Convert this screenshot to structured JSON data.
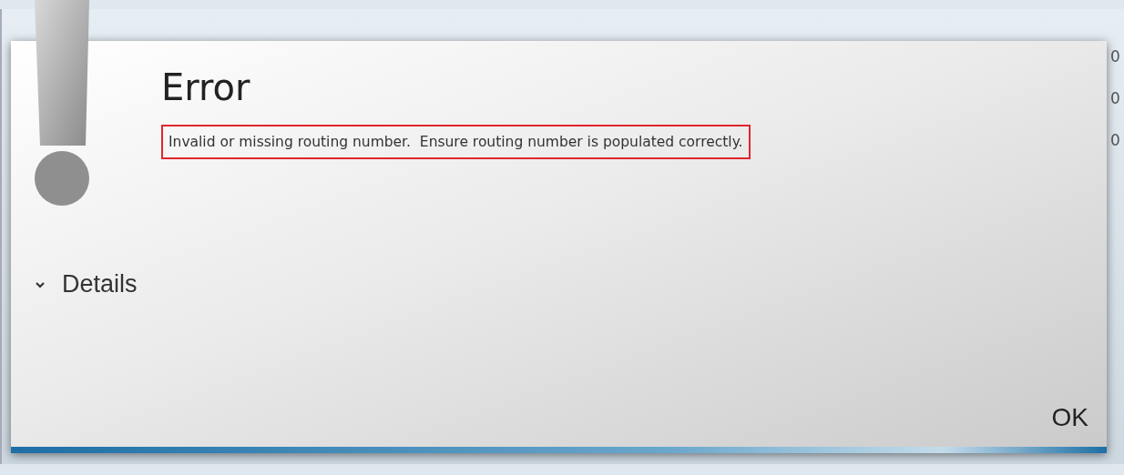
{
  "dialog": {
    "title": "Error",
    "message": "Invalid or missing routing number.  Ensure routing number is populated correctly.",
    "details": {
      "label": "Details",
      "expanded": false
    },
    "buttons": [
      "OK"
    ]
  },
  "background": {
    "column_values": [
      "0",
      "0",
      "0"
    ]
  }
}
